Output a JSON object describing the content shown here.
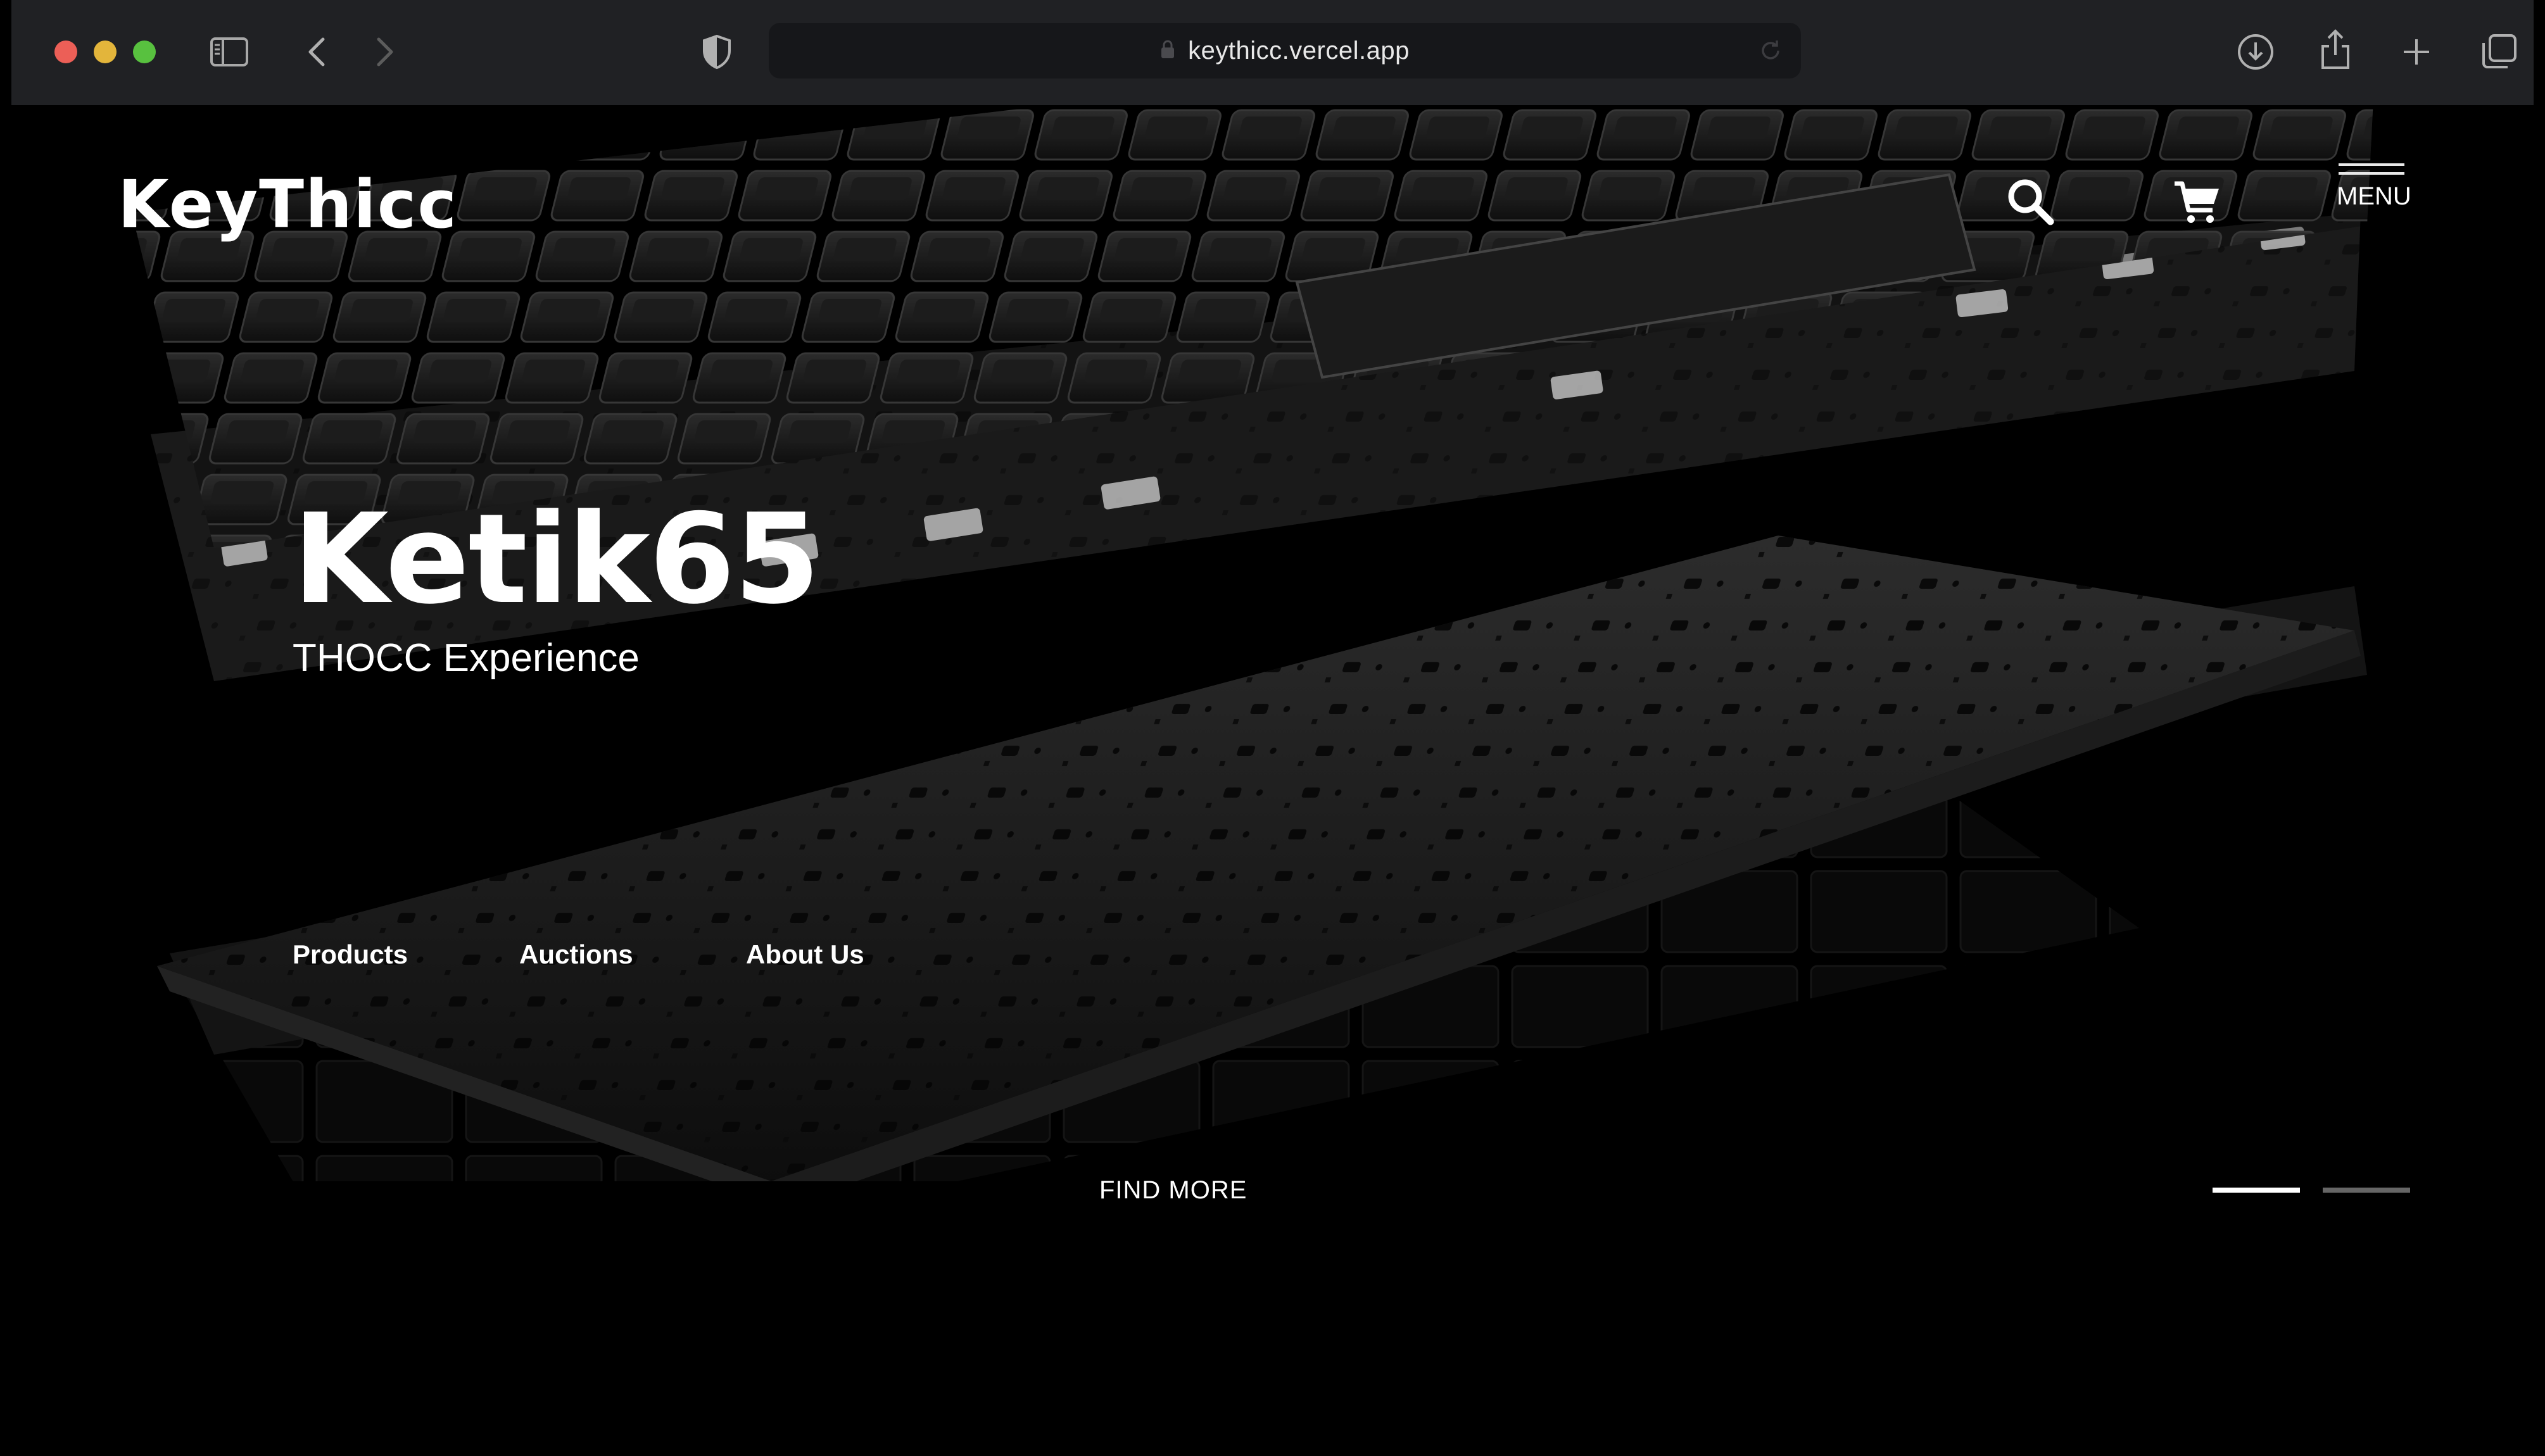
{
  "browser": {
    "url": "keythicc.vercel.app",
    "icons": {
      "sidebar": "sidebar-icon",
      "back": "chevron-left-icon",
      "forward": "chevron-right-icon",
      "privacy": "shield-icon",
      "lock": "lock-icon",
      "reload": "reload-icon",
      "download": "download-icon",
      "share": "share-icon",
      "new_tab": "plus-icon",
      "tabs": "tabs-icon"
    }
  },
  "site": {
    "logo": "KeyThicc",
    "menu_label": "MENU",
    "hero": {
      "title": "Ketik65",
      "subtitle": "THOCC Experience",
      "cta": "FIND MORE"
    },
    "links": [
      "Products",
      "Auctions",
      "About Us"
    ],
    "slider": {
      "count": 2,
      "active": 1
    }
  },
  "colors": {
    "background": "#000000",
    "toolbar": "#202124",
    "text": "#ffffff",
    "dot_active": "#ffffff",
    "dot_inactive": "#666666"
  }
}
